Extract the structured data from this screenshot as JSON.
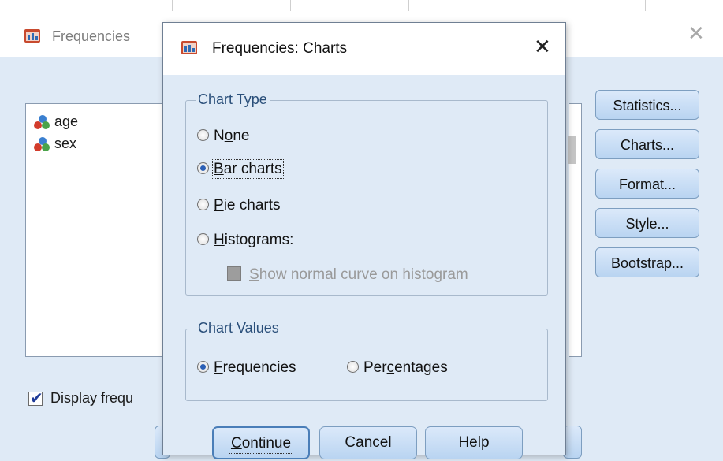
{
  "parent_dialog": {
    "title": "Frequencies",
    "variables": [
      {
        "label": "age"
      },
      {
        "label": "sex"
      }
    ],
    "side_buttons": [
      {
        "label": "Statistics...",
        "mnemonic": "S"
      },
      {
        "label": "Charts...",
        "mnemonic": "C"
      },
      {
        "label": "Format...",
        "mnemonic": "F"
      },
      {
        "label": "Style...",
        "mnemonic": "l"
      },
      {
        "label": "Bootstrap...",
        "mnemonic": "B"
      }
    ],
    "display_checkbox": {
      "label": "Display frequ",
      "checked": true
    }
  },
  "child_dialog": {
    "title": "Frequencies: Charts",
    "chart_type": {
      "legend": "Chart Type",
      "options": [
        {
          "label": "None",
          "selected": false
        },
        {
          "label": "Bar charts",
          "selected": true
        },
        {
          "label": "Pie charts",
          "selected": false
        },
        {
          "label": "Histograms:",
          "selected": false
        }
      ],
      "show_normal_curve": {
        "label": "Show normal curve on histogram",
        "enabled": false
      }
    },
    "chart_values": {
      "legend": "Chart Values",
      "options": [
        {
          "label": "Frequencies",
          "selected": true
        },
        {
          "label": "Percentages",
          "selected": false
        }
      ]
    },
    "buttons": {
      "continue": "Continue",
      "cancel": "Cancel",
      "help": "Help"
    }
  },
  "colors": {
    "dialog_bg": "#dfeaf6",
    "button_top": "#dbe9fa",
    "button_bottom": "#b9d4f1",
    "radio_dot": "#2b5fb5"
  }
}
